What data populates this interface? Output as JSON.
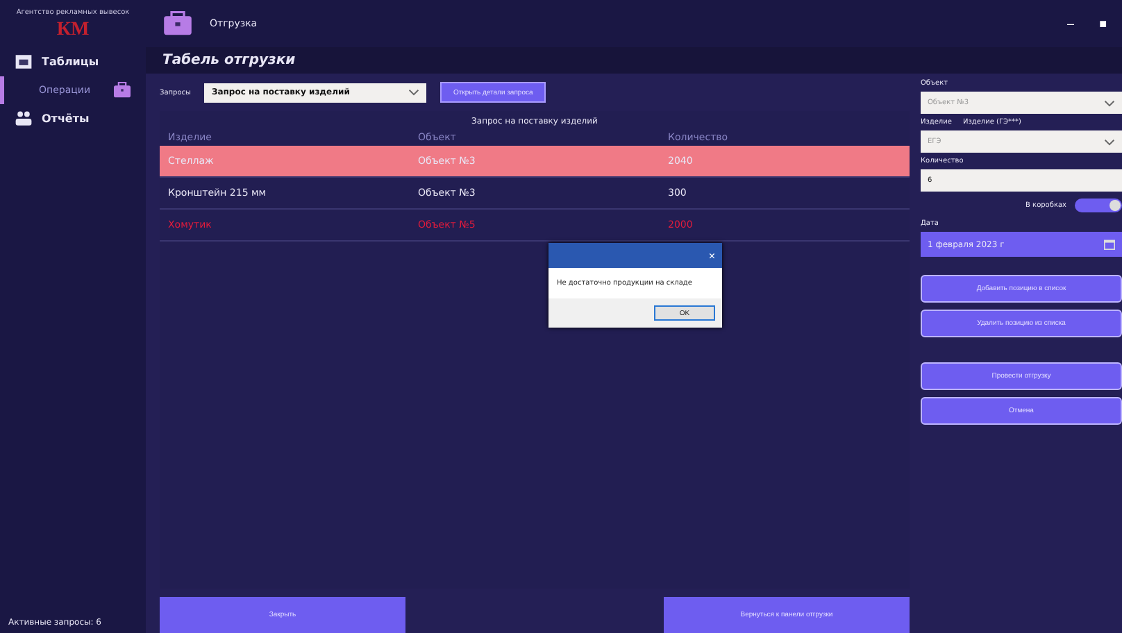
{
  "logo": {
    "caption": "Агентство рекламных вывесок",
    "mark": "КМ"
  },
  "header": {
    "title": "Отгрузка"
  },
  "window_controls": [
    "–",
    "■"
  ],
  "sidebar": {
    "items": [
      {
        "label": "Таблицы",
        "selected": false,
        "children": [
          {
            "label": "Операции",
            "selected": true
          }
        ]
      },
      {
        "label": "Отчёты",
        "selected": false
      }
    ]
  },
  "page_title": "Табель отгрузки",
  "toolbar": {
    "label": "Запросы",
    "combo": "Запрос на поставку изделий",
    "button": "Открыть детали запроса"
  },
  "table": {
    "caption": "Запрос на поставку изделий",
    "columns": [
      "Изделие",
      "Объект",
      "Количество"
    ],
    "rows": [
      {
        "cells": [
          "Стеллаж",
          "Объект №3",
          "2040"
        ],
        "selected": true,
        "shortage": false
      },
      {
        "cells": [
          "Кронштейн 215 мм",
          "Объект №3",
          "300"
        ],
        "selected": false,
        "shortage": false
      },
      {
        "cells": [
          "Хомутик",
          "Объект №5",
          "2000"
        ],
        "selected": false,
        "shortage": true
      }
    ]
  },
  "dialog": {
    "close": "×",
    "message": "Не достаточно продукции на складе",
    "button": "OK"
  },
  "form": {
    "object_label": "Объект",
    "object_value": "Объект №3",
    "product_label": "Изделие",
    "product_hint": "Изделие (ГЭ***)",
    "product_value": "ЕГЭ",
    "quantity_label": "Количество",
    "quantity_value": "6",
    "toggle_label": "В коробках",
    "toggle_on": true,
    "date_label": "Дата",
    "date_value": "1 февраля 2023 г",
    "button_groups": [
      [
        "Добавить позицию в список",
        "Удалить позицию из списка"
      ],
      [
        "Провести отгрузку",
        "Отмена"
      ]
    ]
  },
  "status": "Активные запросы: 6",
  "bottom_buttons": [
    "Закрыть",
    "Вернуться к панели отгрузки"
  ]
}
